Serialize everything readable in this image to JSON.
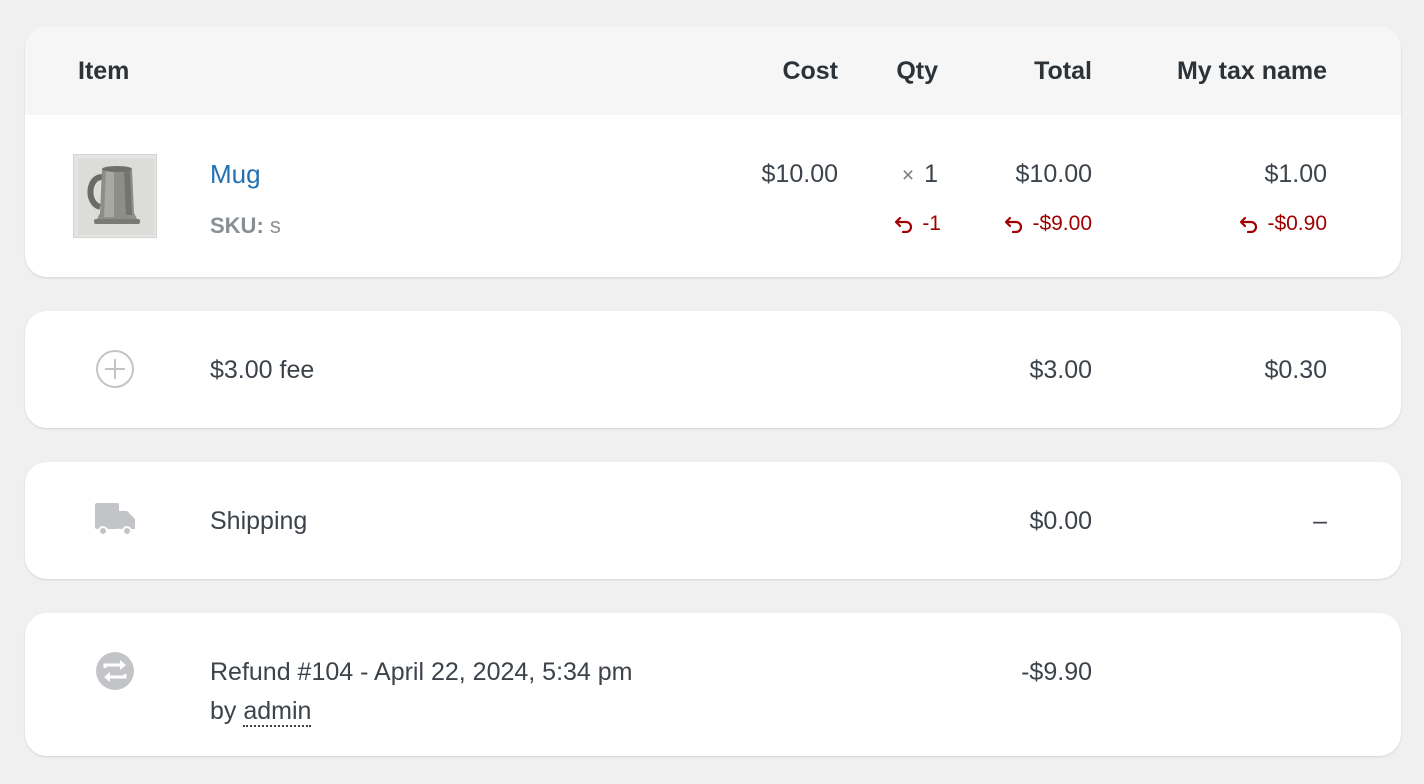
{
  "header": {
    "item": "Item",
    "cost": "Cost",
    "qty": "Qty",
    "total": "Total",
    "tax": "My tax name"
  },
  "line_item": {
    "name": "Mug",
    "sku_label": "SKU:",
    "sku_value": "s",
    "cost": "$10.00",
    "qty_times": "×",
    "qty": "1",
    "qty_refunded": "-1",
    "total": "$10.00",
    "total_refunded": "-$9.00",
    "tax": "$1.00",
    "tax_refunded": "-$0.90",
    "thumbnail_icon": "mug-thumbnail",
    "refund_icon": "undo-arrow-icon",
    "refund_color": "#a00000",
    "link_color": "#2271b1"
  },
  "fee": {
    "icon": "plus-circle-icon",
    "name": "$3.00 fee",
    "total": "$3.00",
    "tax": "$0.30"
  },
  "shipping": {
    "icon": "truck-icon",
    "name": "Shipping",
    "total": "$0.00",
    "tax": "–"
  },
  "refund": {
    "icon": "refund-arrows-icon",
    "title": "Refund #104 - April 22, 2024, 5:34 pm",
    "by_label": "by",
    "by_user": "admin",
    "total": "-$9.90"
  }
}
